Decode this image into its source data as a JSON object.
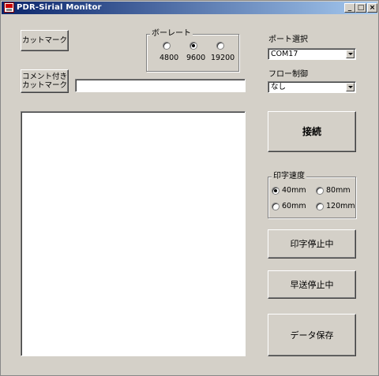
{
  "window": {
    "title": "PDR-Sirial Monitor"
  },
  "caption_buttons": {
    "minimize": "_",
    "maximize": "□",
    "close": "×"
  },
  "buttons": {
    "cut_mark": "カットマーク",
    "comment_cut_mark_line1": "コメント付き",
    "comment_cut_mark_line2": "カットマーク",
    "connect": "接続",
    "print_stop": "印字停止中",
    "feed_stop": "早送停止中",
    "save_data": "データ保存"
  },
  "comment_input": {
    "value": ""
  },
  "baud_rate": {
    "label": "ボーレート",
    "options": [
      {
        "label": "4800",
        "selected": false
      },
      {
        "label": "9600",
        "selected": true
      },
      {
        "label": "19200",
        "selected": false
      }
    ]
  },
  "port_select": {
    "label": "ポート選択",
    "value": "COM17"
  },
  "flow_control": {
    "label": "フロー制御",
    "value": "なし"
  },
  "print_speed": {
    "label": "印字速度",
    "options": [
      {
        "label": "40mm",
        "selected": true
      },
      {
        "label": "80mm",
        "selected": false
      },
      {
        "label": "60mm",
        "selected": false
      },
      {
        "label": "120mm",
        "selected": false
      }
    ]
  },
  "monitor": {
    "text": ""
  }
}
